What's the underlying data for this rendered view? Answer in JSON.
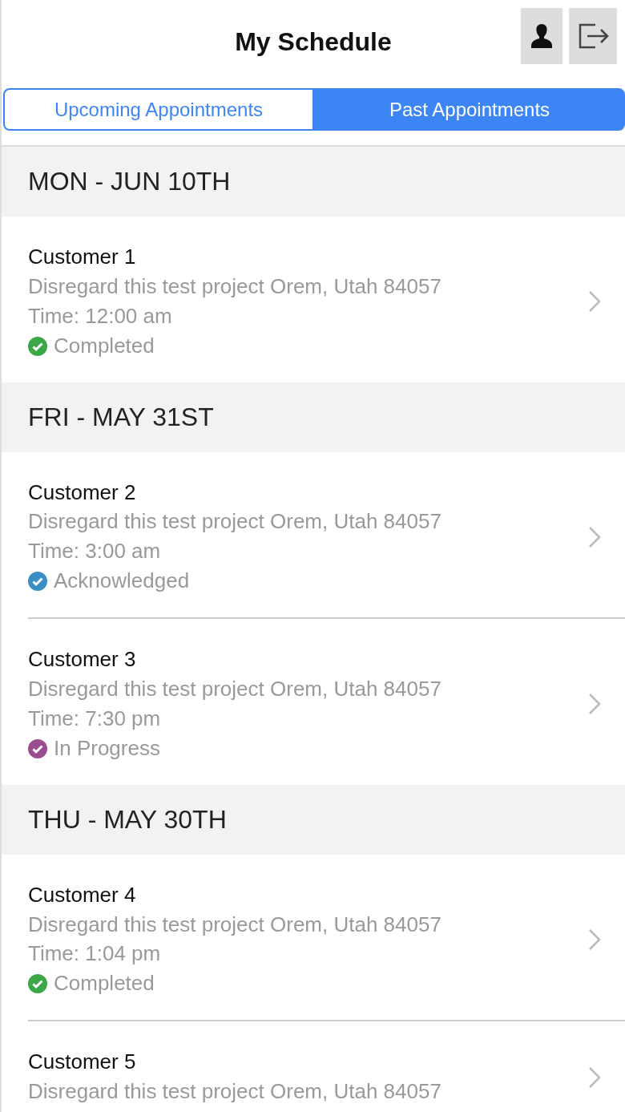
{
  "header": {
    "title": "My Schedule"
  },
  "tabs": [
    {
      "label": "Upcoming Appointments",
      "selected": false
    },
    {
      "label": "Past Appointments",
      "selected": true
    }
  ],
  "days": [
    {
      "date": "MON - JUN 10TH",
      "appointments": [
        {
          "customer": "Customer 1",
          "address": "Disregard this test project Orem, Utah 84057",
          "time": "Time: 12:00 am",
          "status": "Completed",
          "color": "#3aa845"
        }
      ]
    },
    {
      "date": "FRI - MAY 31ST",
      "appointments": [
        {
          "customer": "Customer 2",
          "address": "Disregard this test project Orem, Utah 84057",
          "time": "Time: 3:00 am",
          "status": "Acknowledged",
          "color": "#3a8ec4"
        },
        {
          "customer": "Customer 3",
          "address": "Disregard this test project Orem, Utah 84057",
          "time": "Time: 7:30 pm",
          "status": "In Progress",
          "color": "#9b4b8f"
        }
      ]
    },
    {
      "date": "THU - MAY 30TH",
      "appointments": [
        {
          "customer": "Customer 4",
          "address": "Disregard this test project Orem, Utah 84057",
          "time": "Time: 1:04 pm",
          "status": "Completed",
          "color": "#3aa845"
        },
        {
          "customer": "Customer 5",
          "address": "Disregard this test project Orem, Utah 84057"
        }
      ]
    }
  ]
}
